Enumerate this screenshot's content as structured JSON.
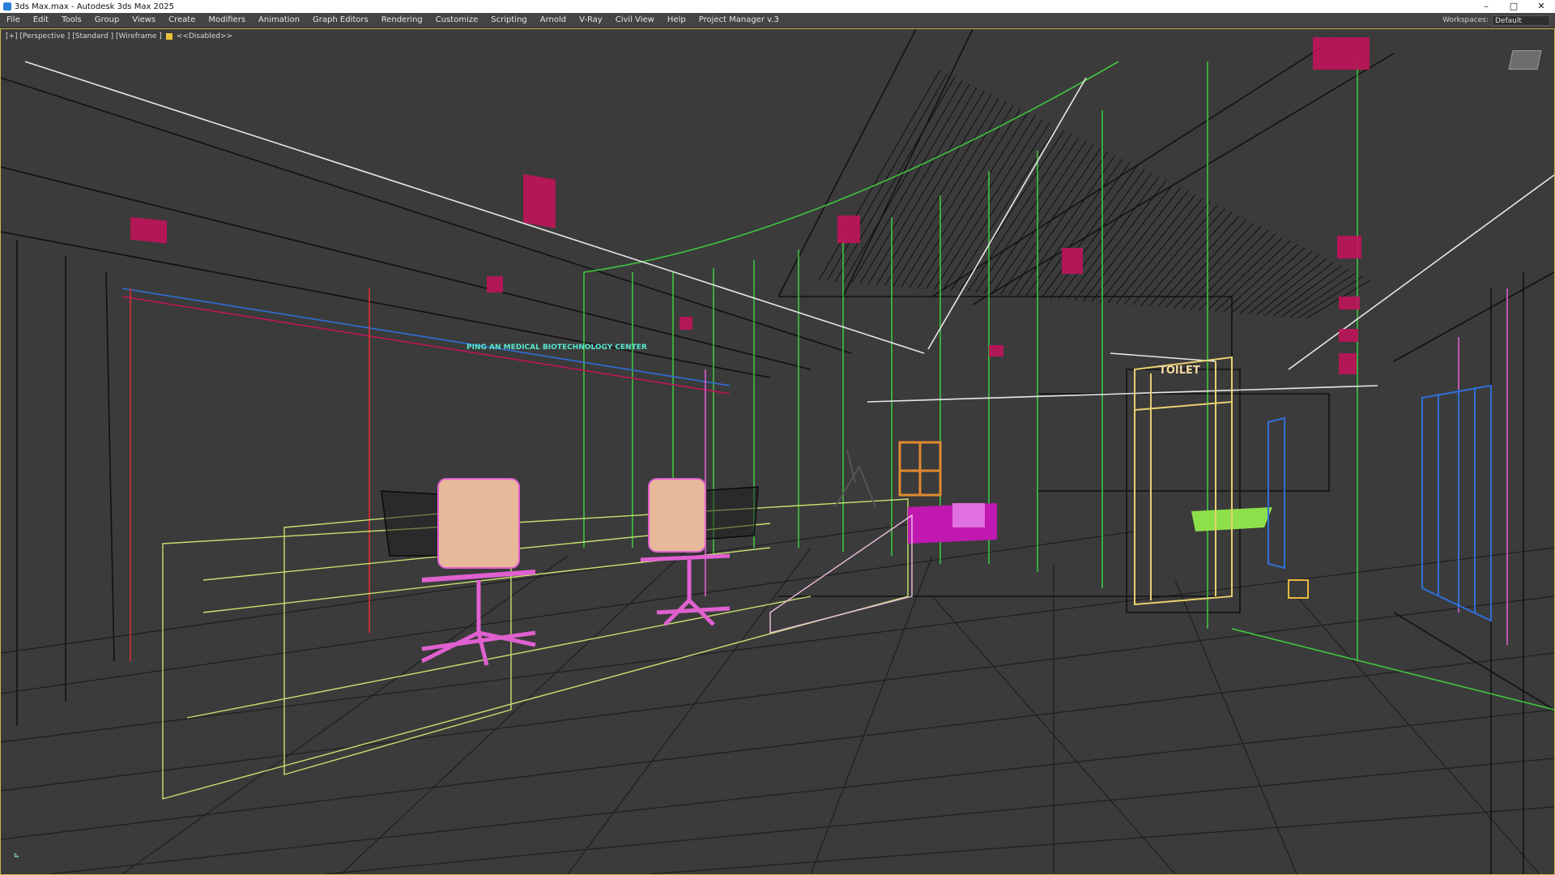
{
  "window": {
    "title": "3ds Max.max - Autodesk 3ds Max 2025",
    "controls": [
      "–",
      "□",
      "✕"
    ]
  },
  "menubar": {
    "items": [
      "File",
      "Edit",
      "Tools",
      "Group",
      "Views",
      "Create",
      "Modifiers",
      "Animation",
      "Graph Editors",
      "Rendering",
      "Customize",
      "Scripting",
      "Arnold",
      "V-Ray",
      "Civil View",
      "Help",
      "Project Manager v.3"
    ],
    "workspaces_label": "Workspaces:",
    "workspaces_value": "Default"
  },
  "viewport": {
    "label": "[+] [Perspective ] [Standard ] [Wireframe ]",
    "disabled": "<<Disabled>>",
    "sign_text": "PING AN MEDICAL BIOTECHNOLOGY CENTER",
    "toilet_text": "TOILET"
  },
  "colors": {
    "accent": "#e8c23a",
    "wire_green": "#3fc53f",
    "wire_magenta": "#c0145a",
    "wire_pink": "#e060d0",
    "wire_blue": "#2f6fd8",
    "wire_yellow": "#d8d070"
  }
}
